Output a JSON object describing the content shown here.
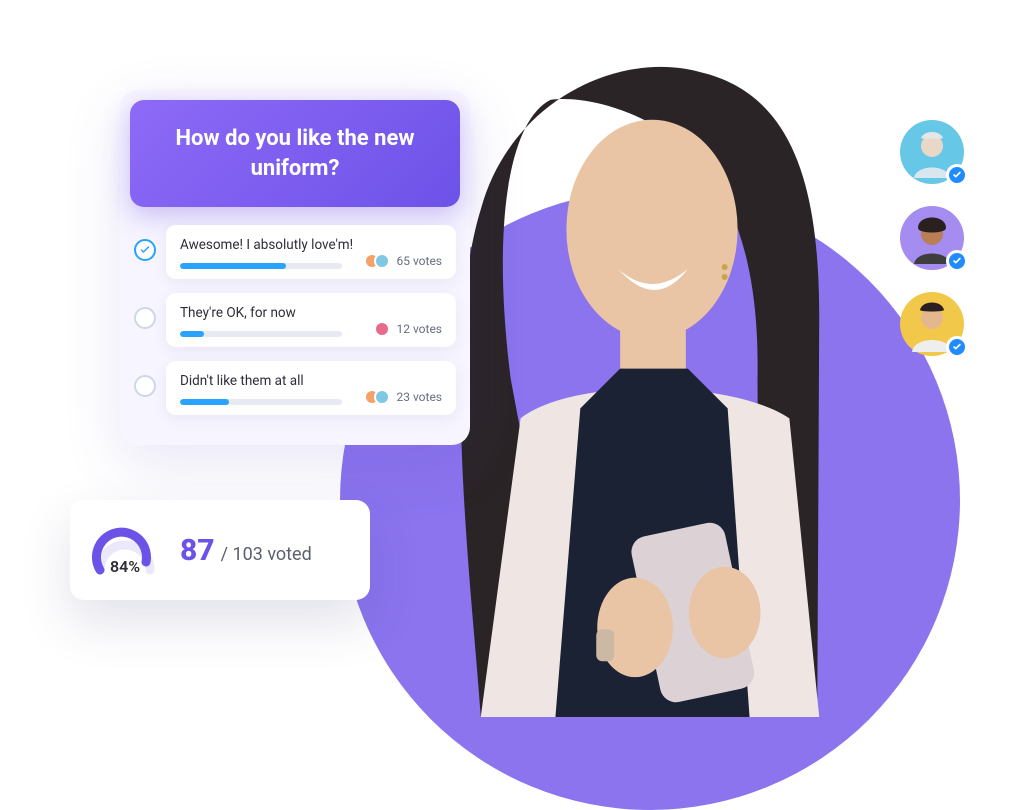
{
  "poll": {
    "question": "How do you like the new uniform?",
    "options": [
      {
        "label": "Awesome! I absolutly love'm!",
        "votes_text": "65 votes",
        "bar_pct": 65,
        "selected": true
      },
      {
        "label": "They're OK, for now",
        "votes_text": "12 votes",
        "bar_pct": 15,
        "selected": false
      },
      {
        "label": "Didn't like them at all",
        "votes_text": "23 votes",
        "bar_pct": 30,
        "selected": false
      }
    ]
  },
  "stats": {
    "gauge_pct_text": "84%",
    "voted_count": "87",
    "voted_total_text": "/ 103 voted"
  },
  "respondent_avatars": {
    "bg_colors": [
      "#67c7e6",
      "#a58cf0",
      "#f2c84b"
    ]
  },
  "mini_avatar_colors": {
    "a": "#f4a26a",
    "b": "#7ec8e3",
    "c": "#e86a8a"
  }
}
